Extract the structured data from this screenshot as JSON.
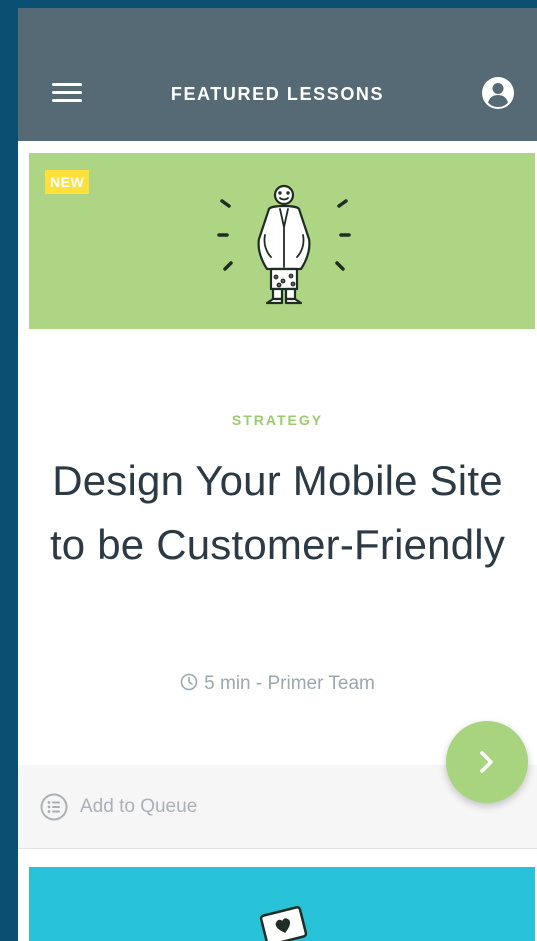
{
  "header": {
    "title": "FEATURED LESSONS",
    "menu_icon": "hamburger-menu-icon",
    "account_icon": "account-circle-icon"
  },
  "lesson": {
    "badge": "NEW",
    "category": "STRATEGY",
    "title": "Design Your Mobile Site to be Customer-Friendly",
    "meta": "5 min - Primer Team",
    "meta_icon": "clock-icon",
    "hero_color": "#add584",
    "add_to_queue_label": "Add to Queue",
    "queue_icon": "queue-list-icon",
    "next_icon": "chevron-right-icon"
  },
  "next_lesson": {
    "hero_color": "#27c2d8",
    "illustration_icon": "heart-card-icon"
  },
  "colors": {
    "app_bar": "#566a76",
    "accent_green": "#9bcb6f",
    "badge_yellow": "#ffe03a",
    "frame": "#0b4f72"
  }
}
